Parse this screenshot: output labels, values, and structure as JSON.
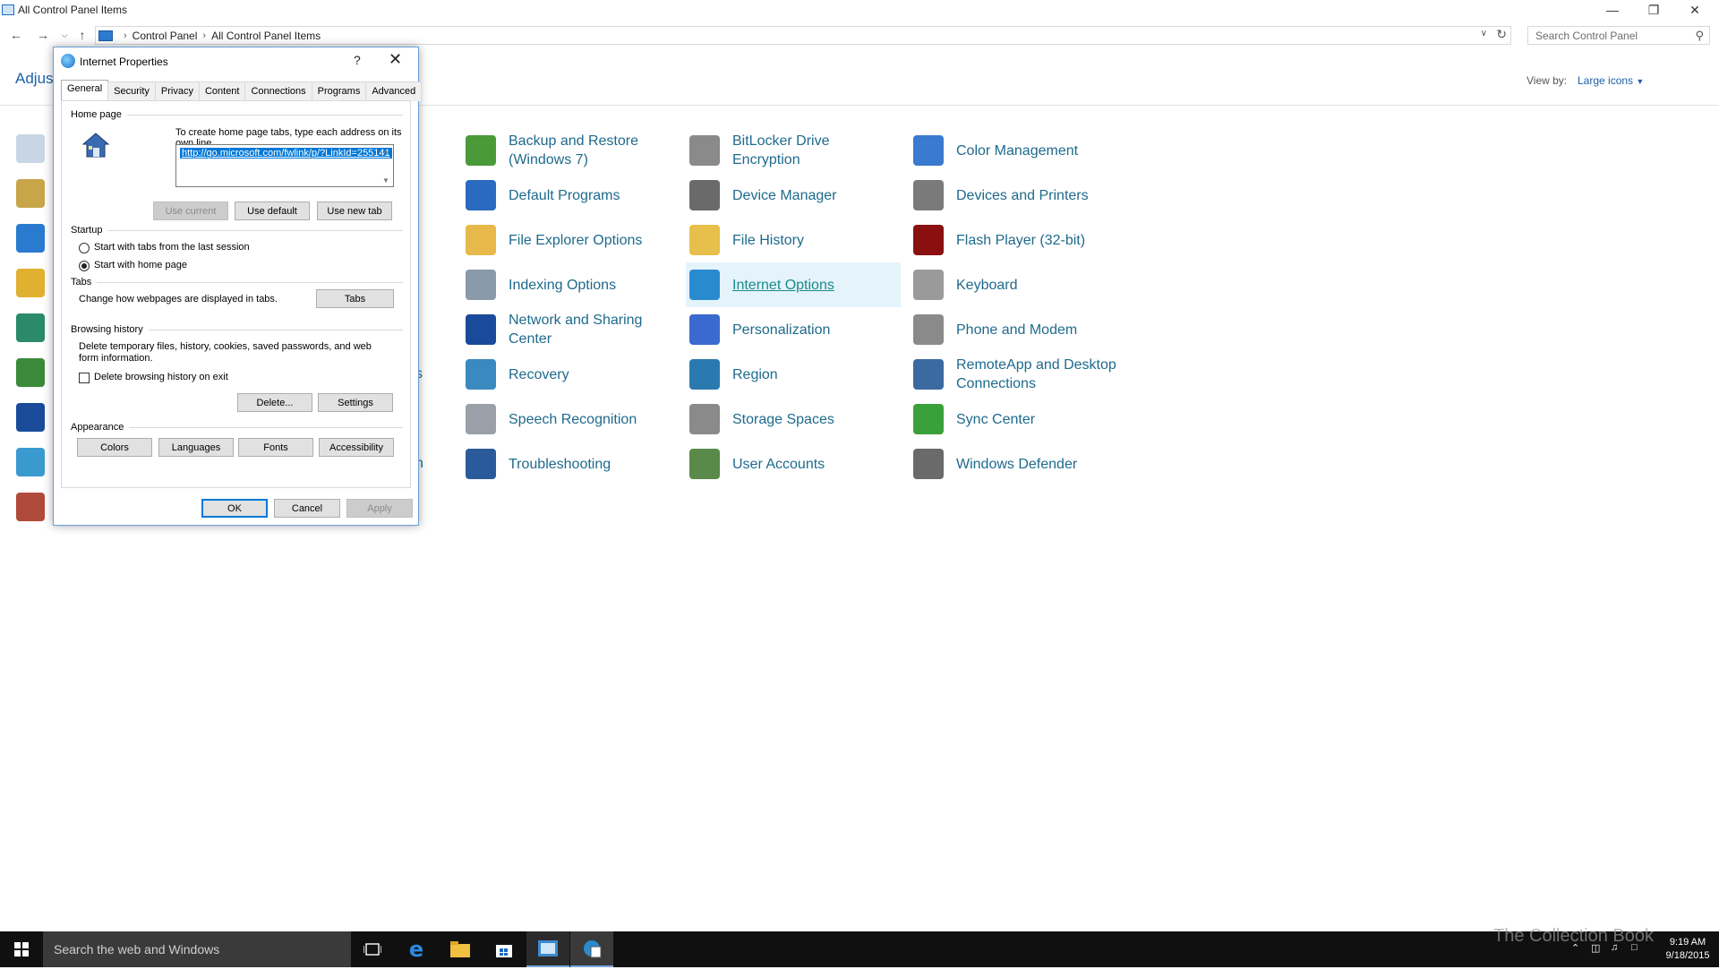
{
  "window": {
    "title": "All Control Panel Items"
  },
  "address": {
    "crumbs": [
      "Control Panel",
      "All Control Panel Items"
    ],
    "search_placeholder": "Search Control Panel"
  },
  "header": {
    "adjust_text": "Adjust",
    "view_by_label": "View by:",
    "view_by_value": "Large icons"
  },
  "items": [
    {
      "label": "Backup and Restore (Windows 7)",
      "icon": "backup-icon",
      "color": "#4a9a3a"
    },
    {
      "label": "BitLocker Drive Encryption",
      "icon": "bitlocker-icon",
      "color": "#8a8a8a"
    },
    {
      "label": "Color Management",
      "icon": "color-management-icon",
      "color": "#3a7ad0"
    },
    {
      "label": "Default Programs",
      "icon": "default-programs-icon",
      "color": "#2a6ac0"
    },
    {
      "label": "Device Manager",
      "icon": "device-manager-icon",
      "color": "#6a6a6a"
    },
    {
      "label": "Devices and Printers",
      "icon": "printer-icon",
      "color": "#7a7a7a"
    },
    {
      "label": "File Explorer Options",
      "icon": "folder-options-icon",
      "color": "#e6b94a"
    },
    {
      "label": "File History",
      "icon": "file-history-icon",
      "color": "#e6c04a"
    },
    {
      "label": "Flash Player (32-bit)",
      "icon": "flash-icon",
      "color": "#8a1010"
    },
    {
      "label": "Indexing Options",
      "icon": "indexing-icon",
      "color": "#8a9aaa"
    },
    {
      "label": "Internet Options",
      "icon": "internet-options-icon",
      "color": "#2a8ad0"
    },
    {
      "label": "Keyboard",
      "icon": "keyboard-icon",
      "color": "#9a9a9a"
    },
    {
      "label": "Network and Sharing Center",
      "icon": "network-icon",
      "color": "#1a4a9a"
    },
    {
      "label": "Personalization",
      "icon": "personalization-icon",
      "color": "#3a6ad0"
    },
    {
      "label": "Phone and Modem",
      "icon": "phone-modem-icon",
      "color": "#8a8a8a"
    },
    {
      "label": "Recovery",
      "icon": "recovery-icon",
      "color": "#3a8ac0"
    },
    {
      "label": "Region",
      "icon": "region-icon",
      "color": "#2a7ab0"
    },
    {
      "label": "RemoteApp and Desktop Connections",
      "icon": "remoteapp-icon",
      "color": "#3a6aa0"
    },
    {
      "label": "Speech Recognition",
      "icon": "microphone-icon",
      "color": "#9aa0a8"
    },
    {
      "label": "Storage Spaces",
      "icon": "storage-spaces-icon",
      "color": "#8a8a8a"
    },
    {
      "label": "Sync Center",
      "icon": "sync-icon",
      "color": "#3aa03a"
    },
    {
      "label": "Troubleshooting",
      "icon": "troubleshooting-icon",
      "color": "#2a5a9a"
    },
    {
      "label": "User Accounts",
      "icon": "user-accounts-icon",
      "color": "#5a8a4a"
    },
    {
      "label": "Windows Defender",
      "icon": "defender-icon",
      "color": "#6a6a6a"
    }
  ],
  "hidden_items_partial": [
    "s",
    "n"
  ],
  "dialog": {
    "title": "Internet Properties",
    "help": "?",
    "tabs": [
      "General",
      "Security",
      "Privacy",
      "Content",
      "Connections",
      "Programs",
      "Advanced"
    ],
    "home_page": {
      "group": "Home page",
      "instructions": "To create home page tabs, type each address on its own line.",
      "url": "http://go.microsoft.com/fwlink/p/?LinkId=255141",
      "use_current": "Use current",
      "use_default": "Use default",
      "use_new_tab": "Use new tab"
    },
    "startup": {
      "group": "Startup",
      "option_last_session": "Start with tabs from the last session",
      "option_home_page": "Start with home page"
    },
    "tabs_group": {
      "group": "Tabs",
      "description": "Change how webpages are displayed in tabs.",
      "button": "Tabs"
    },
    "browsing_history": {
      "group": "Browsing history",
      "description": "Delete temporary files, history, cookies, saved passwords, and web form information.",
      "delete_on_exit": "Delete browsing history on exit",
      "delete_button": "Delete...",
      "settings_button": "Settings"
    },
    "appearance": {
      "group": "Appearance",
      "colors": "Colors",
      "languages": "Languages",
      "fonts": "Fonts",
      "accessibility": "Accessibility"
    },
    "ok": "OK",
    "cancel": "Cancel",
    "apply": "Apply"
  },
  "taskbar": {
    "search_placeholder": "Search the web and Windows",
    "time": "9:19 AM",
    "date": "9/18/2015",
    "watermark": "The Collection Book"
  }
}
